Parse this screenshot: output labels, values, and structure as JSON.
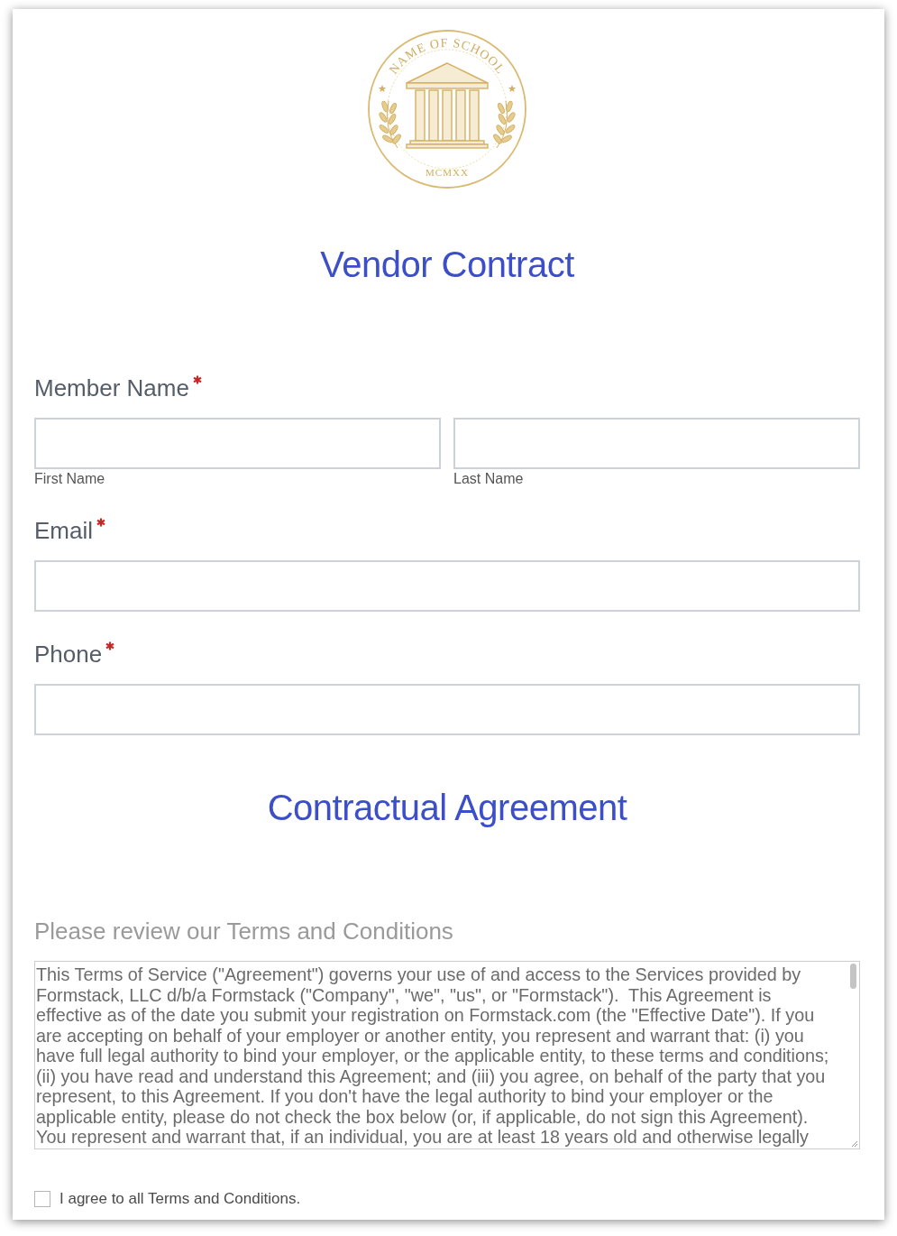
{
  "logo": {
    "ring_text": "NAME OF SCHOOL",
    "year": "MCMXX"
  },
  "title": "Vendor Contract",
  "fields": [
    {
      "kind": "split",
      "label": "Member Name",
      "required": true,
      "inputs": [
        {
          "sublabel": "First Name"
        },
        {
          "sublabel": "Last Name"
        }
      ]
    },
    {
      "kind": "single",
      "label": "Email",
      "required": true
    },
    {
      "kind": "single",
      "label": "Phone",
      "required": true
    }
  ],
  "section_title": "Contractual Agreement",
  "terms": {
    "label": "Please review our Terms and Conditions",
    "text": "This Terms of Service (\"Agreement\") governs your use of and access to the Services provided by Formstack, LLC d/b/a Formstack (\"Company\", \"we\", \"us\", or \"Formstack\").  This Agreement is effective as of the date you submit your registration on Formstack.com (the \"Effective Date\"). If you are accepting on behalf of your employer or another entity, you represent and warrant that: (i) you have full legal authority to bind your employer, or the applicable entity, to these terms and conditions; (ii) you have read and understand this Agreement; and (iii) you agree, on behalf of the party that you represent, to this Agreement. If you don't have the legal authority to bind your employer or the applicable entity, please do not check the box below (or, if applicable, do not sign this Agreement). You represent and warrant that, if an individual, you are at least 18 years old and otherwise legally"
  },
  "agree": {
    "label": "I agree to all Terms and Conditions.",
    "checked": false
  }
}
